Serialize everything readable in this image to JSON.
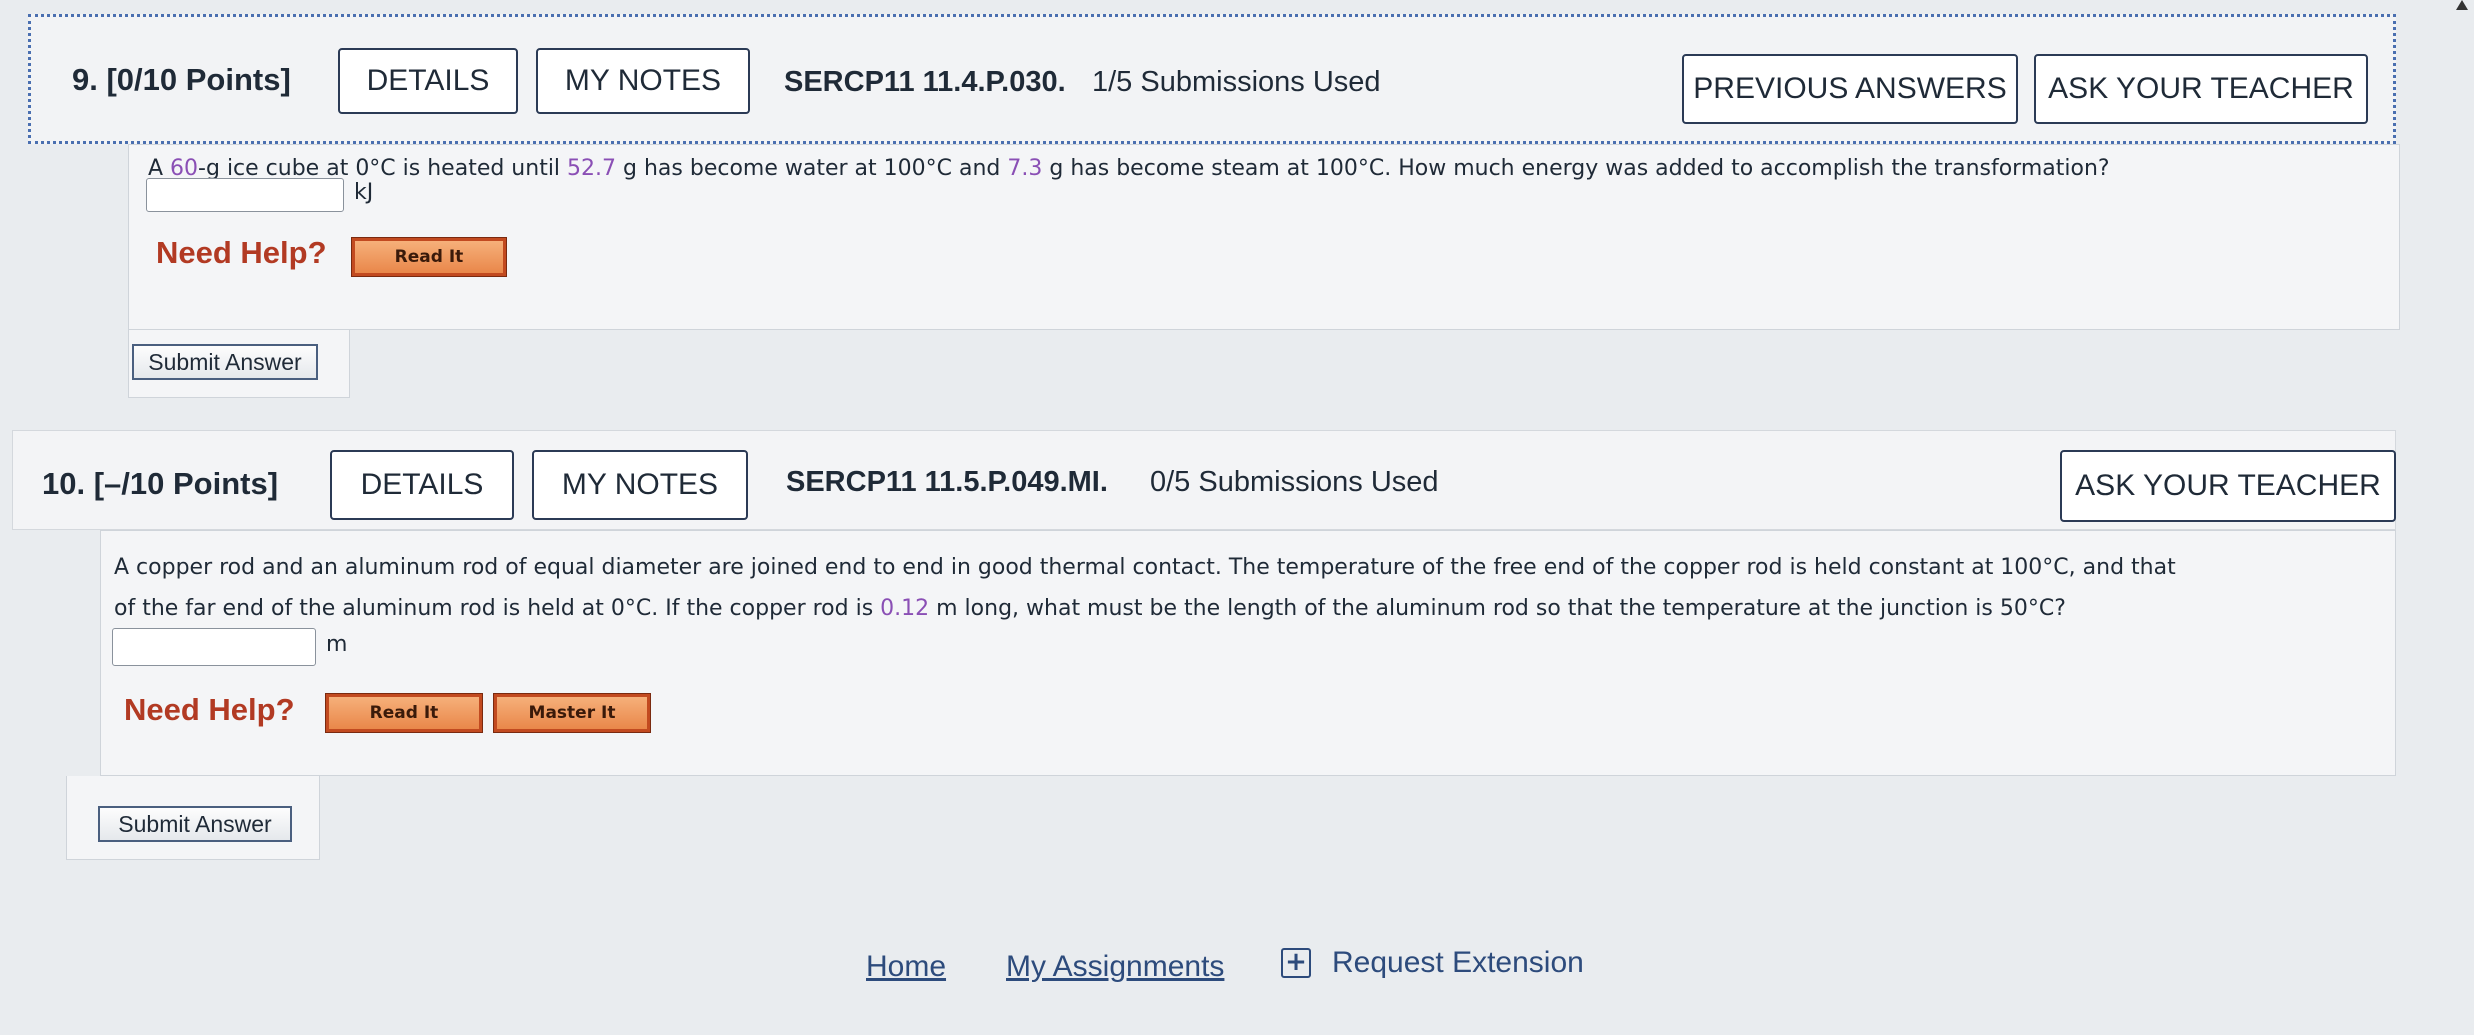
{
  "q9": {
    "header": {
      "number_points": "9.  [0/10 Points]",
      "details": "DETAILS",
      "my_notes": "MY NOTES",
      "code": "SERCP11 11.4.P.030.",
      "submissions": "1/5 Submissions Used",
      "previous_answers": "PREVIOUS ANSWERS",
      "ask_teacher": "ASK YOUR TEACHER"
    },
    "text": {
      "p1": "A ",
      "v1": "60",
      "p2": "-g ice cube at 0°C is heated until ",
      "v2": "52.7",
      "p3": " g has become water at 100°C and ",
      "v3": "7.3",
      "p4": " g has become steam at 100°C. How much energy was added to accomplish the transformation?"
    },
    "answer_value": "",
    "unit": "kJ",
    "need_help": "Need Help?",
    "read_it": "Read It",
    "submit": "Submit Answer"
  },
  "q10": {
    "header": {
      "number_points": "10.  [–/10 Points]",
      "details": "DETAILS",
      "my_notes": "MY NOTES",
      "code": "SERCP11 11.5.P.049.MI.",
      "submissions": "0/5 Submissions Used",
      "ask_teacher": "ASK YOUR TEACHER"
    },
    "text": {
      "line1": "A copper rod and an aluminum rod of equal diameter are joined end to end in good thermal contact. The temperature of the free end of the copper rod is held constant at 100°C, and that",
      "p2": "of the far end of the aluminum rod is held at 0°C. If the copper rod is ",
      "v1": "0.12",
      "p3": " m long, what must be the length of the aluminum rod so that the temperature at the junction is 50°C?"
    },
    "answer_value": "",
    "unit": "m",
    "need_help": "Need Help?",
    "read_it": "Read It",
    "master_it": "Master It",
    "submit": "Submit Answer"
  },
  "footer": {
    "home": "Home",
    "my_assignments": "My Assignments",
    "request_extension": "Request Extension"
  },
  "colors": {
    "highlight": "#8a4fb5",
    "need_help": "#b23a23",
    "link": "#2d4b7c"
  }
}
